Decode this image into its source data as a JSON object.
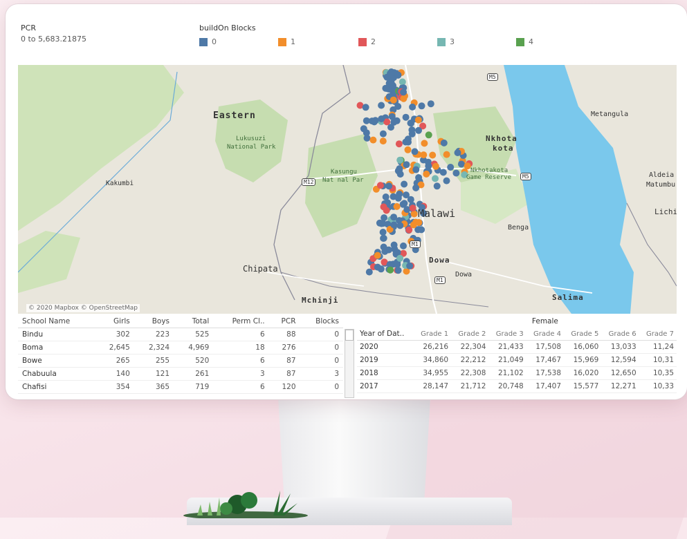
{
  "legend": {
    "pcr_title": "PCR",
    "pcr_range": "0 to 5,683.21875",
    "blocks_title": "buildOn Blocks",
    "items": [
      {
        "label": "0",
        "color": "#4e79a7"
      },
      {
        "label": "1",
        "color": "#f28e2b"
      },
      {
        "label": "2",
        "color": "#e15759"
      },
      {
        "label": "3",
        "color": "#76b7b2"
      },
      {
        "label": "4",
        "color": "#59a14f"
      }
    ]
  },
  "map": {
    "labels": {
      "eastern": "Eastern",
      "lukusuzi": "Lukusuzi",
      "lukusuzi_np": "National Park",
      "kakumbi": "Kakumbi",
      "kasungu": "Kasungu",
      "kasungu_np": "Nat  nal Par",
      "nkhota": "Nkhota",
      "kota": "kota",
      "nkhotakota_gr1": "Nkhotakota",
      "nkhotakota_gr2": "Game Reserve",
      "malawi": "Malawi",
      "metangula": "Metangula",
      "aldeia": "Aldeia",
      "matumbu": "Matumbu",
      "lichi": "Lichi",
      "benga": "Benga",
      "chipata": "Chipata",
      "dowa_bold": "Dowa",
      "dowa": "Dowa",
      "mchinji": "Mchinji",
      "salima": "Salima",
      "m5_top": "M5",
      "m5_right": "M5",
      "m12": "M12",
      "m1_a": "M1",
      "m1_b": "M1"
    },
    "attribution": "© 2020 Mapbox © OpenStreetMap"
  },
  "schools_table": {
    "headers": [
      "School Name",
      "Girls",
      "Boys",
      "Total",
      "Perm Cl..",
      "PCR",
      "Blocks"
    ],
    "rows": [
      [
        "Bindu",
        "302",
        "223",
        "525",
        "6",
        "88",
        "0"
      ],
      [
        "Boma",
        "2,645",
        "2,324",
        "4,969",
        "18",
        "276",
        "0"
      ],
      [
        "Bowe",
        "265",
        "255",
        "520",
        "6",
        "87",
        "0"
      ],
      [
        "Chabuula",
        "140",
        "121",
        "261",
        "3",
        "87",
        "3"
      ],
      [
        "Chafisi",
        "354",
        "365",
        "719",
        "6",
        "120",
        "0"
      ]
    ]
  },
  "grades_table": {
    "group_label": "Female",
    "year_header": "Year of Dat..",
    "grade_headers": [
      "Grade 1",
      "Grade 2",
      "Grade 3",
      "Grade 4",
      "Grade 5",
      "Grade 6",
      "Grade 7"
    ],
    "rows": [
      {
        "year": "2020",
        "values": [
          "26,216",
          "22,304",
          "21,433",
          "17,508",
          "16,060",
          "13,033",
          "11,24"
        ]
      },
      {
        "year": "2019",
        "values": [
          "34,860",
          "22,212",
          "21,049",
          "17,467",
          "15,969",
          "12,594",
          "10,31"
        ]
      },
      {
        "year": "2018",
        "values": [
          "34,955",
          "22,308",
          "21,102",
          "17,538",
          "16,020",
          "12,650",
          "10,35"
        ]
      },
      {
        "year": "2017",
        "values": [
          "28,147",
          "21,712",
          "20,748",
          "17,407",
          "15,577",
          "12,271",
          "10,33"
        ]
      }
    ]
  }
}
